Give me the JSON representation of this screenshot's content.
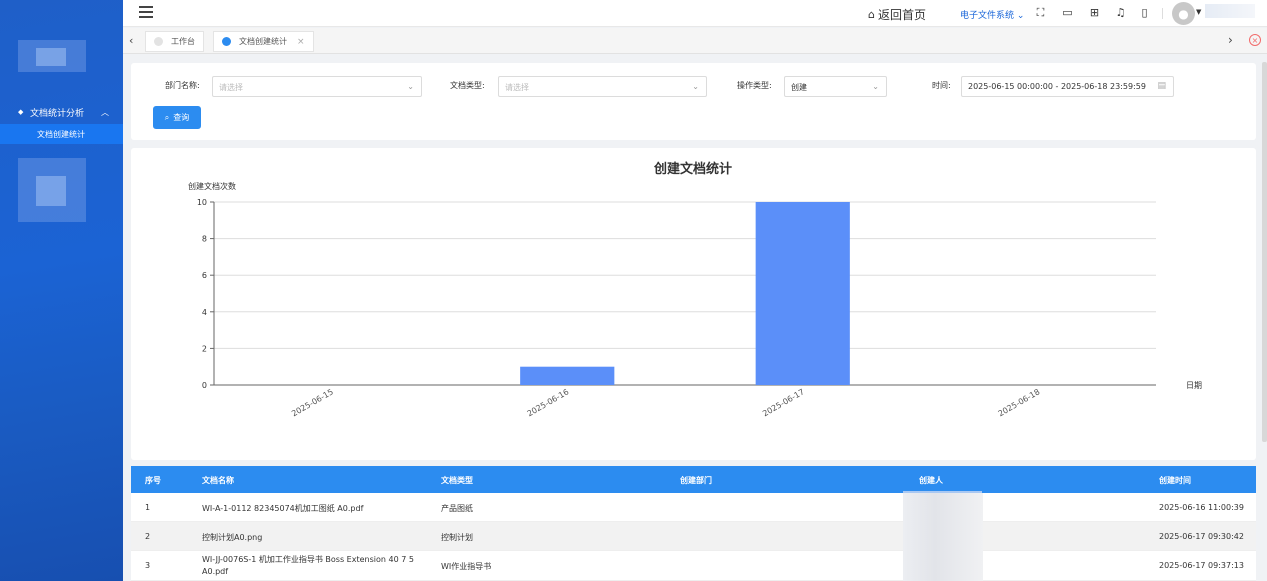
{
  "topbar": {
    "home_label": "返回首页",
    "system_label": "电子文件系统",
    "icons": [
      "fullscreen-icon",
      "monitor-icon",
      "grid-icon",
      "bell-icon",
      "mobile-icon"
    ]
  },
  "sidebar": {
    "group_label": "文档统计分析",
    "items": [
      {
        "label": "文档创建统计"
      }
    ]
  },
  "tabs": [
    {
      "label": "工作台",
      "color": "#e3e3e3"
    },
    {
      "label": "文档创建统计",
      "color": "#2c8cf0"
    }
  ],
  "filter": {
    "dept_label": "部门名称:",
    "dept_placeholder": "请选择",
    "doctype_label": "文档类型:",
    "doctype_placeholder": "请选择",
    "optype_label": "操作类型:",
    "optype_value": "创建",
    "time_label": "时间:",
    "time_value": "2025-06-15 00:00:00 - 2025-06-18 23:59:59",
    "query_label": "查询"
  },
  "chart_data": {
    "type": "bar",
    "title": "创建文档统计",
    "ylabel": "创建文档次数",
    "xlabel": "日期",
    "categories": [
      "2025-06-15",
      "2025-06-16",
      "2025-06-17",
      "2025-06-18"
    ],
    "values": [
      0,
      1,
      10,
      0
    ],
    "ylim": [
      0,
      10
    ],
    "yticks": [
      0,
      2,
      4,
      6,
      8,
      10
    ],
    "bar_color": "#5b8ff9",
    "grid": true
  },
  "table": {
    "headers": [
      "序号",
      "文档名称",
      "文档类型",
      "创建部门",
      "创建人",
      "创建时间"
    ],
    "rows": [
      {
        "no": "1",
        "name": "WI-A-1-0112 82345074机加工图纸 A0.pdf",
        "type": "产品图纸",
        "dept": "",
        "time": "2025-06-16 11:00:39"
      },
      {
        "no": "2",
        "name": "控制计划A0.png",
        "type": "控制计划",
        "dept": "",
        "time": "2025-06-17 09:30:42"
      },
      {
        "no": "3",
        "name": "WI-JJ-0076S-1 机加工作业指导书 Boss Extension 40 7 5 A0.pdf",
        "type": "WI作业指导书",
        "dept": "",
        "time": "2025-06-17 09:37:13"
      }
    ]
  }
}
